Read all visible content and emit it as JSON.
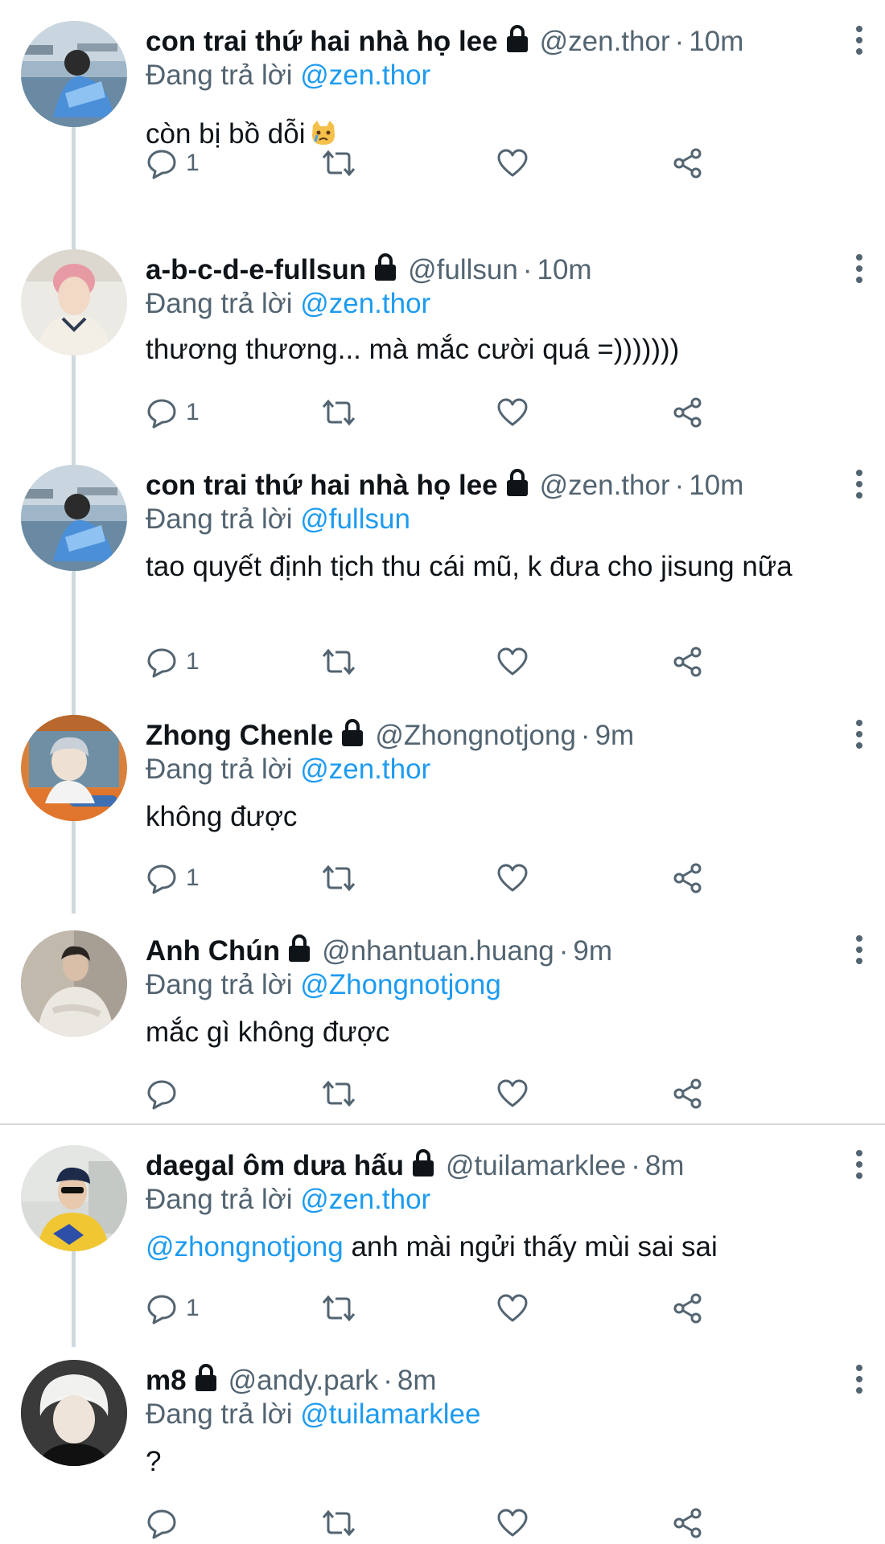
{
  "replying_prefix": "Đang trả lời",
  "tweets": [
    {
      "name": "con trai thứ hai nhà họ lee",
      "handle": "@zen.thor",
      "dot": "·",
      "time": "10m",
      "replying_to": "@zen.thor",
      "text": "còn bị bồ dỗi",
      "emoji": "crying-cat-emoji",
      "reply_count": "1"
    },
    {
      "name": "a-b-c-d-e-fullsun",
      "handle": "@fullsun",
      "dot": "·",
      "time": "10m",
      "replying_to": "@zen.thor",
      "text": "thương thương... mà mắc cười quá =)))))))",
      "reply_count": "1"
    },
    {
      "name": "con trai thứ hai nhà họ lee",
      "handle": "@zen.thor",
      "dot": "·",
      "time": "10m",
      "replying_to": "@fullsun",
      "text": "tao quyết định tịch thu cái mũ, k đưa cho jisung nữa",
      "reply_count": "1"
    },
    {
      "name": "Zhong Chenle",
      "handle": "@Zhongnotjong",
      "dot": "·",
      "time": "9m",
      "replying_to": "@zen.thor",
      "text": "không được",
      "reply_count": "1"
    },
    {
      "name": "Anh Chún",
      "handle": "@nhantuan.huang",
      "dot": "·",
      "time": "9m",
      "replying_to": "@Zhongnotjong",
      "text": "mắc gì không được",
      "reply_count": ""
    },
    {
      "name": "daegal ôm dưa hấu",
      "handle": "@tuilamarklee",
      "dot": "·",
      "time": "8m",
      "replying_to": "@zen.thor",
      "text_mention": "@zhongnotjong",
      "text": " anh mài ngửi thấy mùi sai sai",
      "reply_count": "1"
    },
    {
      "name": "m8",
      "handle": "@andy.park",
      "dot": "·",
      "time": "8m",
      "replying_to": "@tuilamarklee",
      "text": "?",
      "reply_count": ""
    }
  ],
  "icons": {
    "lock": "lock-icon",
    "more": "more-vertical-icon",
    "reply": "reply-bubble-icon",
    "retweet": "retweet-icon",
    "like": "heart-icon",
    "share": "share-icon"
  },
  "colors": {
    "link": "#1d9bf0",
    "secondary_text": "#536471",
    "thread_line": "#cfd9de"
  }
}
